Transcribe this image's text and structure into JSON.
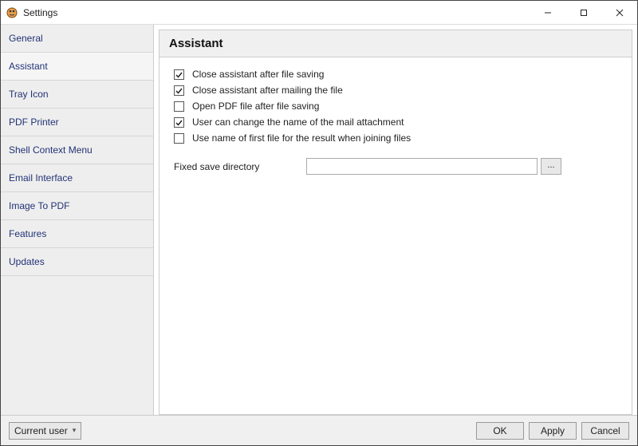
{
  "window": {
    "title": "Settings"
  },
  "sidebar": {
    "items": [
      {
        "label": "General"
      },
      {
        "label": "Assistant"
      },
      {
        "label": "Tray Icon"
      },
      {
        "label": "PDF Printer"
      },
      {
        "label": "Shell Context Menu"
      },
      {
        "label": "Email Interface"
      },
      {
        "label": "Image To PDF"
      },
      {
        "label": "Features"
      },
      {
        "label": "Updates"
      }
    ],
    "active_index": 1
  },
  "panel": {
    "title": "Assistant",
    "options": [
      {
        "label": "Close assistant after file saving",
        "checked": true
      },
      {
        "label": "Close assistant after mailing the file",
        "checked": true
      },
      {
        "label": "Open PDF file after file saving",
        "checked": false
      },
      {
        "label": "User can change the name of the mail attachment",
        "checked": true
      },
      {
        "label": "Use name of first file for the result when joining files",
        "checked": false
      }
    ],
    "save_dir": {
      "label": "Fixed save directory",
      "value": "",
      "browse_label": "..."
    }
  },
  "bottom": {
    "scope_selected": "Current user",
    "ok": "OK",
    "apply": "Apply",
    "cancel": "Cancel"
  }
}
